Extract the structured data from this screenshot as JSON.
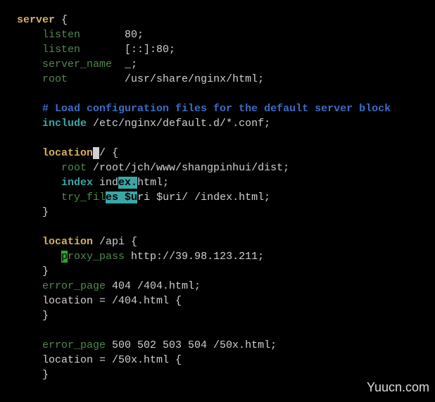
{
  "line1": {
    "kw": "server",
    "rest": " {"
  },
  "line2": {
    "kw": "listen",
    "val": "80;"
  },
  "line3": {
    "kw": "listen",
    "val": "[::]:80;"
  },
  "line4": {
    "kw": "server_name",
    "val": "_;"
  },
  "line5": {
    "kw": "root",
    "val": "/usr/share/nginx/html;"
  },
  "line6": {
    "comment": "# Load configuration files for the default server block"
  },
  "line7": {
    "kw": "include",
    "val": " /etc/nginx/default.d/*.conf;"
  },
  "line8": {
    "kw": "location",
    "cursor": " ",
    "slash": "/",
    "brace": " {"
  },
  "line9": {
    "kw": "root",
    "val": " /root/jch/www/shangpinhui/dist;"
  },
  "line10": {
    "kw": "index",
    "val1": " ind",
    "hl": "ex.",
    "val2": "html;"
  },
  "line11": {
    "kw": "try_fil",
    "hl1": "es ",
    "hl2": "$u",
    "val": "ri $uri/ /index.html;"
  },
  "line12": {
    "brace": "}"
  },
  "line13": {
    "kw": "location",
    "val": " /api {"
  },
  "line14": {
    "hl": "p",
    "kw": "roxy_pass",
    "val": " http://39.98.123.211;"
  },
  "line15": {
    "brace": "}"
  },
  "line16": {
    "kw": "error_page",
    "val": " 404 /404.html;"
  },
  "line17": {
    "pre": "location = /404.html {"
  },
  "line18": {
    "brace": "}"
  },
  "line19": {
    "kw": "error_page",
    "val": " 500 502 503 504 /50x.html;"
  },
  "line20": {
    "pre": "location = /50x.html {"
  },
  "line21": {
    "brace": "}"
  },
  "watermark": "Yuucn.com"
}
